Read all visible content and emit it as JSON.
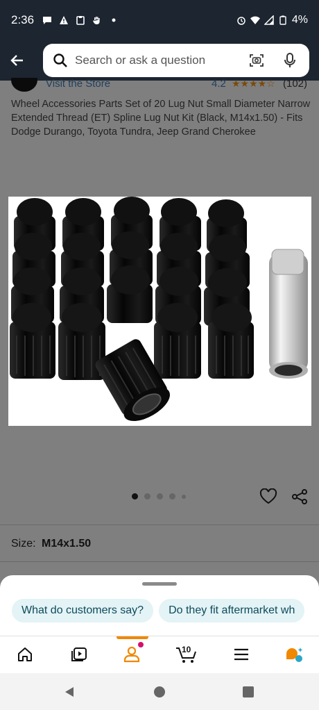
{
  "status_bar": {
    "time": "2:36",
    "battery": "4%",
    "left_icons": [
      "chat-bubble-icon",
      "warning-icon",
      "clipboard-icon",
      "hand-icon",
      "dot-icon"
    ],
    "right_icons": [
      "alarm-icon",
      "wifi-icon",
      "signal-icon",
      "battery-icon"
    ]
  },
  "search": {
    "placeholder": "Search or ask a question"
  },
  "store": {
    "link_label": "Visit the Store",
    "rating": "4.2",
    "stars_text": "★★★★☆",
    "review_count": "(102)"
  },
  "product": {
    "title": "Wheel Accessories Parts Set of 20 Lug Nut Small Diameter Narrow Extended Thread (ET) Spline Lug Nut Kit (Black, M14x1.50) - Fits Dodge Durango, Toyota Tundra, Jeep Grand Cherokee",
    "image_pager": {
      "total": 5,
      "active": 1
    }
  },
  "options": {
    "size_label": "Size:",
    "size_value": "M14x1.50"
  },
  "suggestions": {
    "chips": [
      "What do customers say?",
      "Do they fit aftermarket wh"
    ]
  },
  "tab_bar": {
    "cart_count": "10",
    "accent_color": "#f08804",
    "notification_color": "#d5106a",
    "items": [
      "home-icon",
      "video-icon",
      "account-icon",
      "cart-icon",
      "menu-icon",
      "rufus-icon"
    ]
  },
  "colors": {
    "header_bg": "#1c2530",
    "chip_bg": "#e3f3f6",
    "chip_text": "#0e4a5a"
  }
}
